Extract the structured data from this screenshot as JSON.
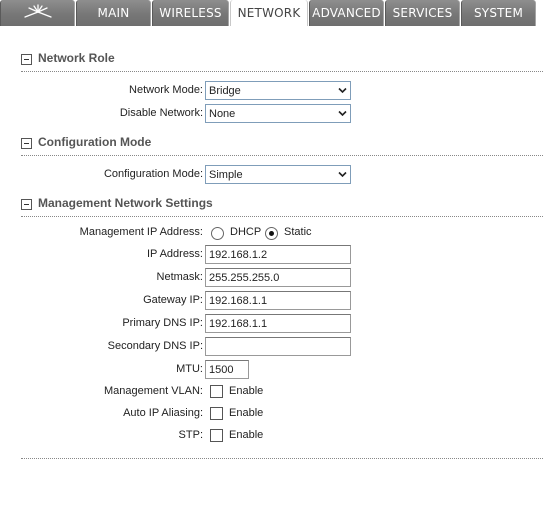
{
  "tabs": {
    "logo_icon": "ubiquiti-logo-icon",
    "main": "MAIN",
    "wireless": "WIRELESS",
    "network": "NETWORK",
    "advanced": "ADVANCED",
    "services": "SERVICES",
    "system": "SYSTEM",
    "active": "NETWORK"
  },
  "network_role": {
    "title": "Network Role",
    "network_mode_label": "Network Mode:",
    "network_mode_value": "Bridge",
    "disable_network_label": "Disable Network:",
    "disable_network_value": "None"
  },
  "configuration_mode": {
    "title": "Configuration Mode",
    "label": "Configuration Mode:",
    "value": "Simple"
  },
  "management": {
    "title": "Management Network Settings",
    "ip_mode_label": "Management IP Address:",
    "dhcp_label": "DHCP",
    "static_label": "Static",
    "ip_mode_selected": "Static",
    "ip_label": "IP Address:",
    "ip_value": "192.168.1.2",
    "netmask_label": "Netmask:",
    "netmask_value": "255.255.255.0",
    "gateway_label": "Gateway IP:",
    "gateway_value": "192.168.1.1",
    "primary_dns_label": "Primary DNS IP:",
    "primary_dns_value": "192.168.1.1",
    "secondary_dns_label": "Secondary DNS IP:",
    "secondary_dns_value": "",
    "mtu_label": "MTU:",
    "mtu_value": "1500",
    "vlan_label": "Management VLAN:",
    "vlan_enable_label": "Enable",
    "aliasing_label": "Auto IP Aliasing:",
    "aliasing_enable_label": "Enable",
    "stp_label": "STP:",
    "stp_enable_label": "Enable"
  }
}
